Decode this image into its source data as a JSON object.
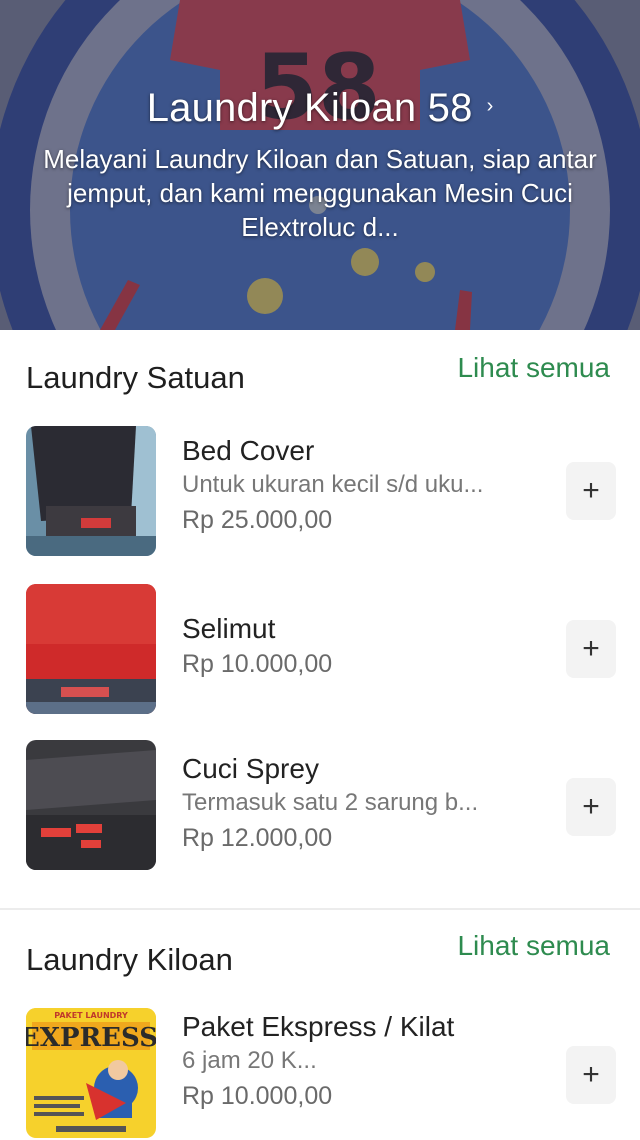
{
  "header": {
    "title": "Laundry Kiloan 58",
    "description": "Melayani Laundry Kiloan dan Satuan, siap antar jemput, dan kami menggunakan Mesin Cuci Elextroluc d...",
    "logo_text": "58",
    "icon": "chevron-right-icon"
  },
  "sections": [
    {
      "title": "Laundry Satuan",
      "see_all": "Lihat semua",
      "items": [
        {
          "name": "Bed Cover",
          "desc": "Untuk ukuran kecil s/d uku...",
          "price": "Rp 25.000,00",
          "add": "+"
        },
        {
          "name": "Selimut",
          "desc": "",
          "price": "Rp 10.000,00",
          "add": "+"
        },
        {
          "name": "Cuci Sprey",
          "desc": "Termasuk satu 2 sarung b...",
          "price": "Rp 12.000,00",
          "add": "+"
        }
      ]
    },
    {
      "title": "Laundry Kiloan",
      "see_all": "Lihat semua",
      "items": [
        {
          "name": "Paket Ekspress / Kilat",
          "desc": "6 jam 20 K...",
          "price": "Rp 10.000,00",
          "add": "+",
          "thumb_text": "EXPRESS",
          "thumb_banner": "PAKET LAUNDRY"
        }
      ]
    }
  ],
  "colors": {
    "accent": "#2e8b4f",
    "hero_red": "#c8262b",
    "hero_blue": "#1e3c8c"
  }
}
